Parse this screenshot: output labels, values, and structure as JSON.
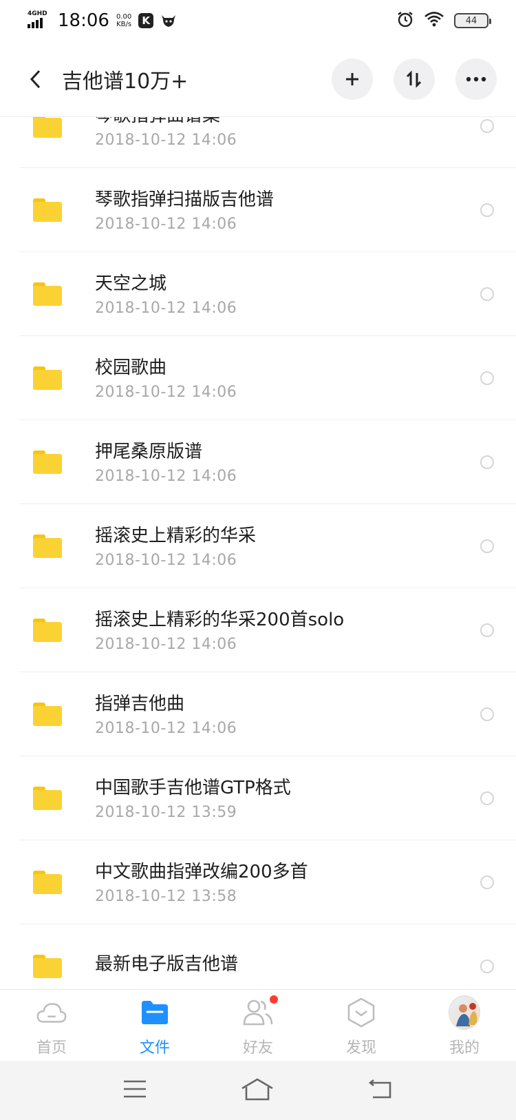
{
  "status_bar": {
    "time": "18:06",
    "network_type": "4GHD",
    "speed_value": "0.00",
    "speed_unit": "KB/s",
    "k_app_icon": "K",
    "battery_level": "44"
  },
  "header": {
    "title": "吉他谱10万+",
    "icons": [
      "back-icon",
      "plus-icon",
      "sort-icon",
      "more-icon"
    ]
  },
  "files": [
    {
      "name": "琴歌指弹曲谱集",
      "date": "2018-10-12  14:06"
    },
    {
      "name": "琴歌指弹扫描版吉他谱",
      "date": "2018-10-12  14:06"
    },
    {
      "name": "天空之城",
      "date": "2018-10-12  14:06"
    },
    {
      "name": "校园歌曲",
      "date": "2018-10-12  14:06"
    },
    {
      "name": "押尾桑原版谱",
      "date": "2018-10-12  14:06"
    },
    {
      "name": "摇滚史上精彩的华采",
      "date": "2018-10-12  14:06"
    },
    {
      "name": "摇滚史上精彩的华采200首solo",
      "date": "2018-10-12  14:06"
    },
    {
      "name": "指弹吉他曲",
      "date": "2018-10-12  14:06"
    },
    {
      "name": "中国歌手吉他谱GTP格式",
      "date": "2018-10-12  13:59"
    },
    {
      "name": "中文歌曲指弹改编200多首",
      "date": "2018-10-12  13:58"
    },
    {
      "name": "最新电子版吉他谱",
      "date": ""
    }
  ],
  "tabbar": {
    "items": [
      {
        "label": "首页",
        "icon": "cloud-icon"
      },
      {
        "label": "文件",
        "icon": "folder-icon"
      },
      {
        "label": "好友",
        "icon": "friends-icon"
      },
      {
        "label": "发现",
        "icon": "discover-icon"
      },
      {
        "label": "我的",
        "icon": "avatar"
      }
    ],
    "active_index": 1
  },
  "colors": {
    "accent": "#1e90ff",
    "folder": "#fbd234",
    "badge": "#ff3b30"
  }
}
